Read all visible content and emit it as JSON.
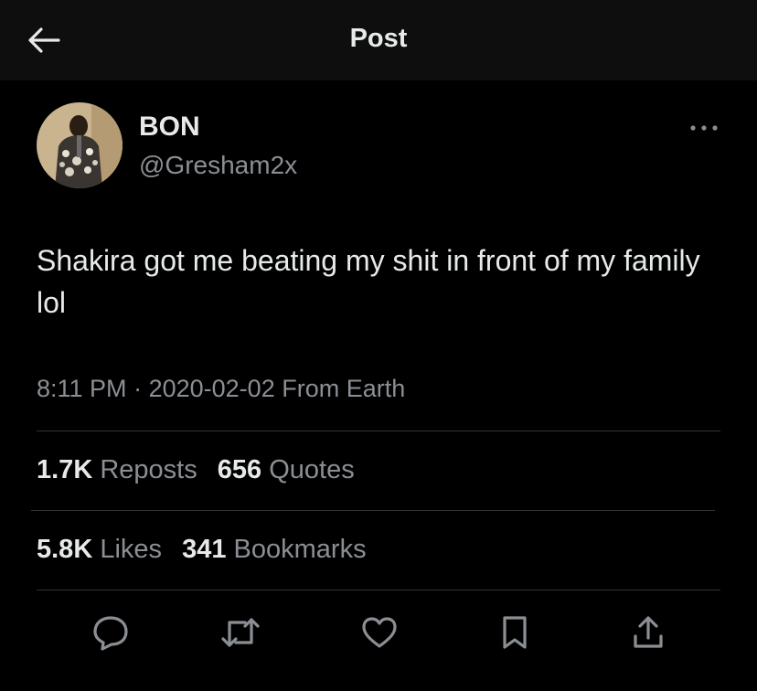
{
  "header": {
    "title": "Post",
    "back_icon": "arrow-left-icon"
  },
  "author": {
    "display_name": "BON",
    "handle": "@Gresham2x",
    "avatar": "avatar-photo"
  },
  "post": {
    "text": "Shakira got me beating my shit in front of my family lol",
    "time": "8:11 PM",
    "separator": "·",
    "date": "2020-02-02",
    "source": "From Earth"
  },
  "stats": {
    "reposts": {
      "count": "1.7K",
      "label": "Reposts"
    },
    "quotes": {
      "count": "656",
      "label": "Quotes"
    },
    "likes": {
      "count": "5.8K",
      "label": "Likes"
    },
    "bookmarks": {
      "count": "341",
      "label": "Bookmarks"
    }
  },
  "actions": [
    "reply-icon",
    "repost-icon",
    "like-icon",
    "bookmark-icon",
    "share-icon"
  ],
  "colors": {
    "background": "#000000",
    "header_bg": "#0e0e0e",
    "text_primary": "#e7e9ea",
    "text_secondary": "#8b8f94",
    "divider": "#2f3336"
  }
}
